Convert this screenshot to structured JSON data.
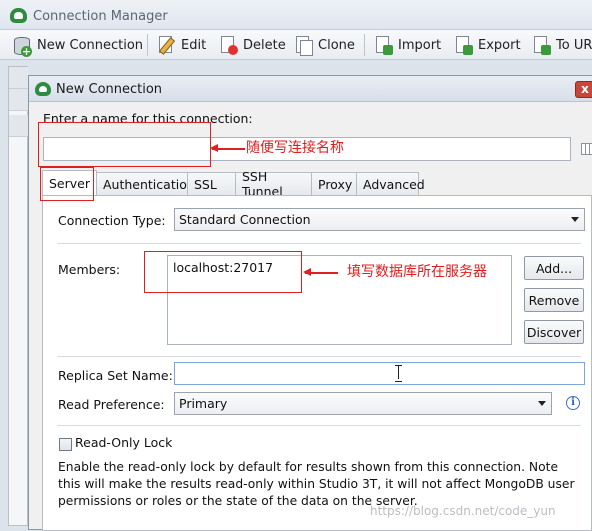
{
  "app": {
    "title": "Connection Manager"
  },
  "toolbar": {
    "new_connection": "New Connection",
    "edit": "Edit",
    "delete": "Delete",
    "clone": "Clone",
    "import": "Import",
    "export": "Export",
    "to_url": "To UR"
  },
  "dialog": {
    "title": "New Connection",
    "close_symbol": "x",
    "name_prompt": "Enter a name for this connection:",
    "name_value": "",
    "tabs": [
      {
        "label": "Server",
        "active": true
      },
      {
        "label": "Authentication",
        "active": false
      },
      {
        "label": "SSL",
        "active": false
      },
      {
        "label": "SSH Tunnel",
        "active": false
      },
      {
        "label": "Proxy",
        "active": false
      },
      {
        "label": "Advanced",
        "active": false
      }
    ],
    "server": {
      "connection_type_label": "Connection Type:",
      "connection_type_value": "Standard Connection",
      "members_label": "Members:",
      "members_value": "localhost:27017",
      "buttons": {
        "add": "Add...",
        "remove": "Remove",
        "discover": "Discover"
      },
      "replica_set_label": "Replica Set Name:",
      "replica_set_value": "",
      "read_pref_label": "Read Preference:",
      "read_pref_value": "Primary",
      "read_only_label": "Read-Only Lock",
      "read_only_checked": false,
      "description": "Enable the read-only lock by default for results shown from this connection. Note this will make the results read-only within Studio 3T, it will not affect MongoDB user permissions or roles or the state of the data on the server."
    }
  },
  "annotations": {
    "name_note": "随便写连接名称",
    "members_note": "填写数据库所在服务器"
  },
  "watermark": "https://blog.csdn.net/code_yun",
  "colors": {
    "annotation": "#e02020",
    "brand": "#2e8b3f"
  }
}
